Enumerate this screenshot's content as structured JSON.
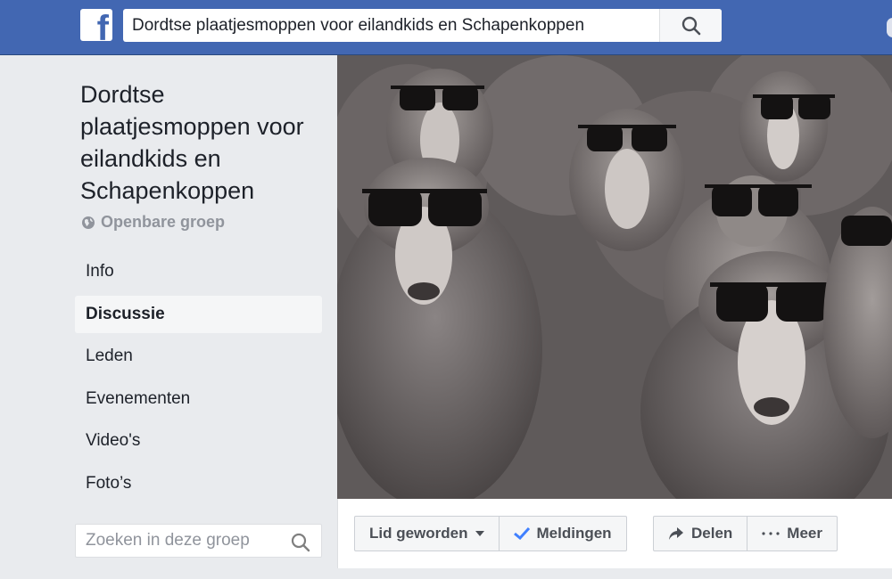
{
  "topbar": {
    "logo_letter": "f",
    "search_value": "Dordtse plaatjesmoppen voor eilandkids en Schapenkoppen",
    "icons": {
      "search": "search-icon",
      "logo": "facebook-logo-icon"
    }
  },
  "group": {
    "title": "Dordtse plaatjesmoppen voor eilandkids en Schapenkoppen",
    "privacy_label": "Openbare groep",
    "privacy_icon": "globe-icon"
  },
  "nav": {
    "items": [
      {
        "label": "Info"
      },
      {
        "label": "Discussie",
        "active": true
      },
      {
        "label": "Leden"
      },
      {
        "label": "Evenementen"
      },
      {
        "label": "Video's"
      },
      {
        "label": "Foto’s"
      }
    ]
  },
  "group_search": {
    "placeholder": "Zoeken in deze groep",
    "icon": "search-icon"
  },
  "cover": {
    "icon": "cover-photo-sheep-with-sunglasses"
  },
  "actions": {
    "join_label": "Lid geworden",
    "notifications_label": "Meldingen",
    "share_label": "Delen",
    "more_label": "Meer"
  },
  "colors": {
    "brand_blue": "#4267b2",
    "page_bg": "#e9ebee",
    "text": "#1d2129",
    "muted": "#90949c",
    "check_blue": "#4080ff"
  }
}
